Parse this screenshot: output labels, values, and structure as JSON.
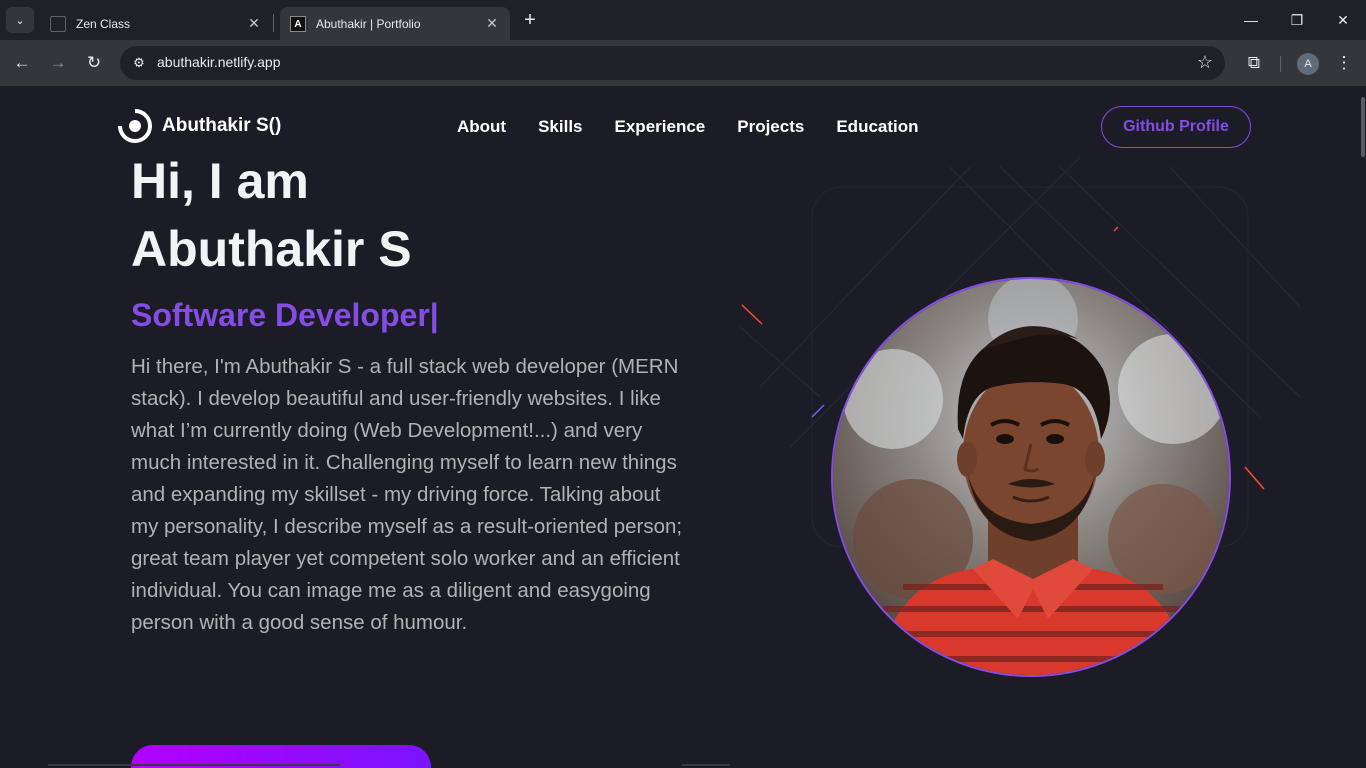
{
  "browser": {
    "tabs": [
      {
        "title": "Zen Class",
        "active": false
      },
      {
        "title": "Abuthakir | Portfolio",
        "active": true
      }
    ],
    "url": "abuthakir.netlify.app",
    "profile_initial": "A"
  },
  "nav": {
    "brand": "Abuthakir S()",
    "links": [
      "About",
      "Skills",
      "Experience",
      "Projects",
      "Education"
    ],
    "github_button": "Github Profile"
  },
  "hero": {
    "greeting": "Hi, I am",
    "name": "Abuthakir S",
    "role": "Software Developer|",
    "bio": "Hi there, I'm Abuthakir S - a full stack web developer (MERN stack). I develop beautiful and user-friendly websites. I like what I’m currently doing (Web Development!...) and very much interested in it. Challenging myself to learn new things and expanding my skillset - my driving force. Talking about my personality, I describe myself as a result-oriented person; great team player yet competent solo worker and an efficient individual. You can image me as a diligent and easygoing person with a good sense of humour."
  },
  "colors": {
    "accent": "#854ce6",
    "background": "#1c1c27",
    "text_primary": "#f2f3f4",
    "text_secondary": "#b1b2b3"
  }
}
